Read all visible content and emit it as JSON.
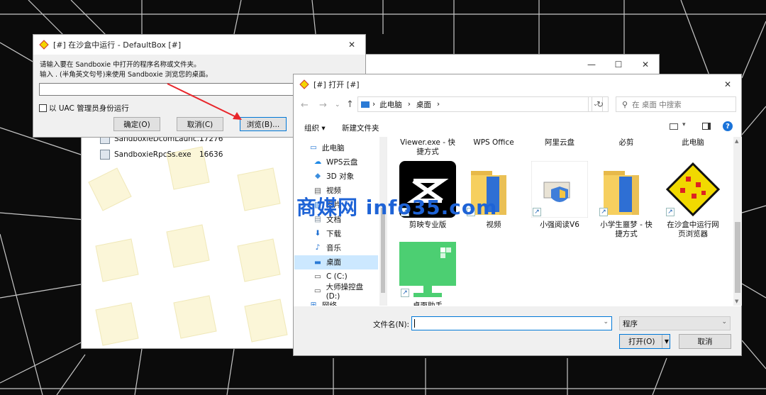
{
  "run_dialog": {
    "title": "[#] 在沙盒中运行 - DefaultBox [#]",
    "close_glyph": "✕",
    "line1": "请输入要在 Sandboxie 中打开的程序名称或文件夹。",
    "line2": "输入 . (半角英文句号)来使用 Sandboxie 浏览您的桌面。",
    "input_value": "",
    "uac_label": "以 UAC 管理员身份运行",
    "ok_label": "确定(O)",
    "cancel_label": "取消(C)",
    "browse_label": "浏览(B)..."
  },
  "process_window": {
    "controls": [
      "—",
      "☐",
      "✕"
    ],
    "rows": [
      {
        "name": "SandboxieDcomLaunc...",
        "pid": "17276"
      },
      {
        "name": "SandboxieRpcSs.exe",
        "pid": "16636"
      }
    ]
  },
  "open_dialog": {
    "title": "[#] 打开 [#]",
    "close_glyph": "✕",
    "breadcrumb": [
      "此电脑",
      "桌面"
    ],
    "search_placeholder": "在 桌面 中搜索",
    "organize_label": "组织",
    "new_folder_label": "新建文件夹",
    "sidebar": [
      {
        "label": "此电脑",
        "icon": "computer-icon",
        "indent": 0
      },
      {
        "label": "WPS云盘",
        "icon": "cloud-icon",
        "indent": 1
      },
      {
        "label": "3D 对象",
        "icon": "cube-icon",
        "indent": 1
      },
      {
        "label": "视频",
        "icon": "video-icon",
        "indent": 1
      },
      {
        "label": "图片",
        "icon": "picture-icon",
        "indent": 1
      },
      {
        "label": "文档",
        "icon": "document-icon",
        "indent": 1
      },
      {
        "label": "下载",
        "icon": "download-icon",
        "indent": 1
      },
      {
        "label": "音乐",
        "icon": "music-icon",
        "indent": 1
      },
      {
        "label": "桌面",
        "icon": "desktop-icon",
        "indent": 1,
        "selected": true
      },
      {
        "label": "C (C:)",
        "icon": "drive-icon",
        "indent": 1
      },
      {
        "label": "大师操控盘 (D:)",
        "icon": "drive-icon",
        "indent": 1
      },
      {
        "label": "网络",
        "icon": "network-icon",
        "indent": 0
      }
    ],
    "top_row_files": [
      "Viewer.exe - 快\n捷方式",
      "WPS Office",
      "阿里云盘",
      "必剪",
      "此电脑"
    ],
    "files": [
      {
        "label": "剪映专业版",
        "icon": "capcut-icon"
      },
      {
        "label": "视频",
        "icon": "folder-icon"
      },
      {
        "label": "小强阅读V6",
        "icon": "installer-icon"
      },
      {
        "label": "小学生噩梦 - 快\n捷方式",
        "icon": "folder-icon"
      },
      {
        "label": "在沙盒中运行网\n页浏览器",
        "icon": "sandboxie-icon"
      },
      {
        "label": "桌面助手",
        "icon": "monitor-icon"
      }
    ],
    "filename_label": "文件名(N):",
    "filename_value": "",
    "filetype_value": "程序",
    "open_label": "打开(O)",
    "cancel_label": "取消"
  },
  "watermark": "商媒网 info35.com",
  "colors": {
    "accent": "#0078d7",
    "watermark": "#1e63d6",
    "annotation_arrow": "#e8262b",
    "selection": "#cce8ff"
  }
}
